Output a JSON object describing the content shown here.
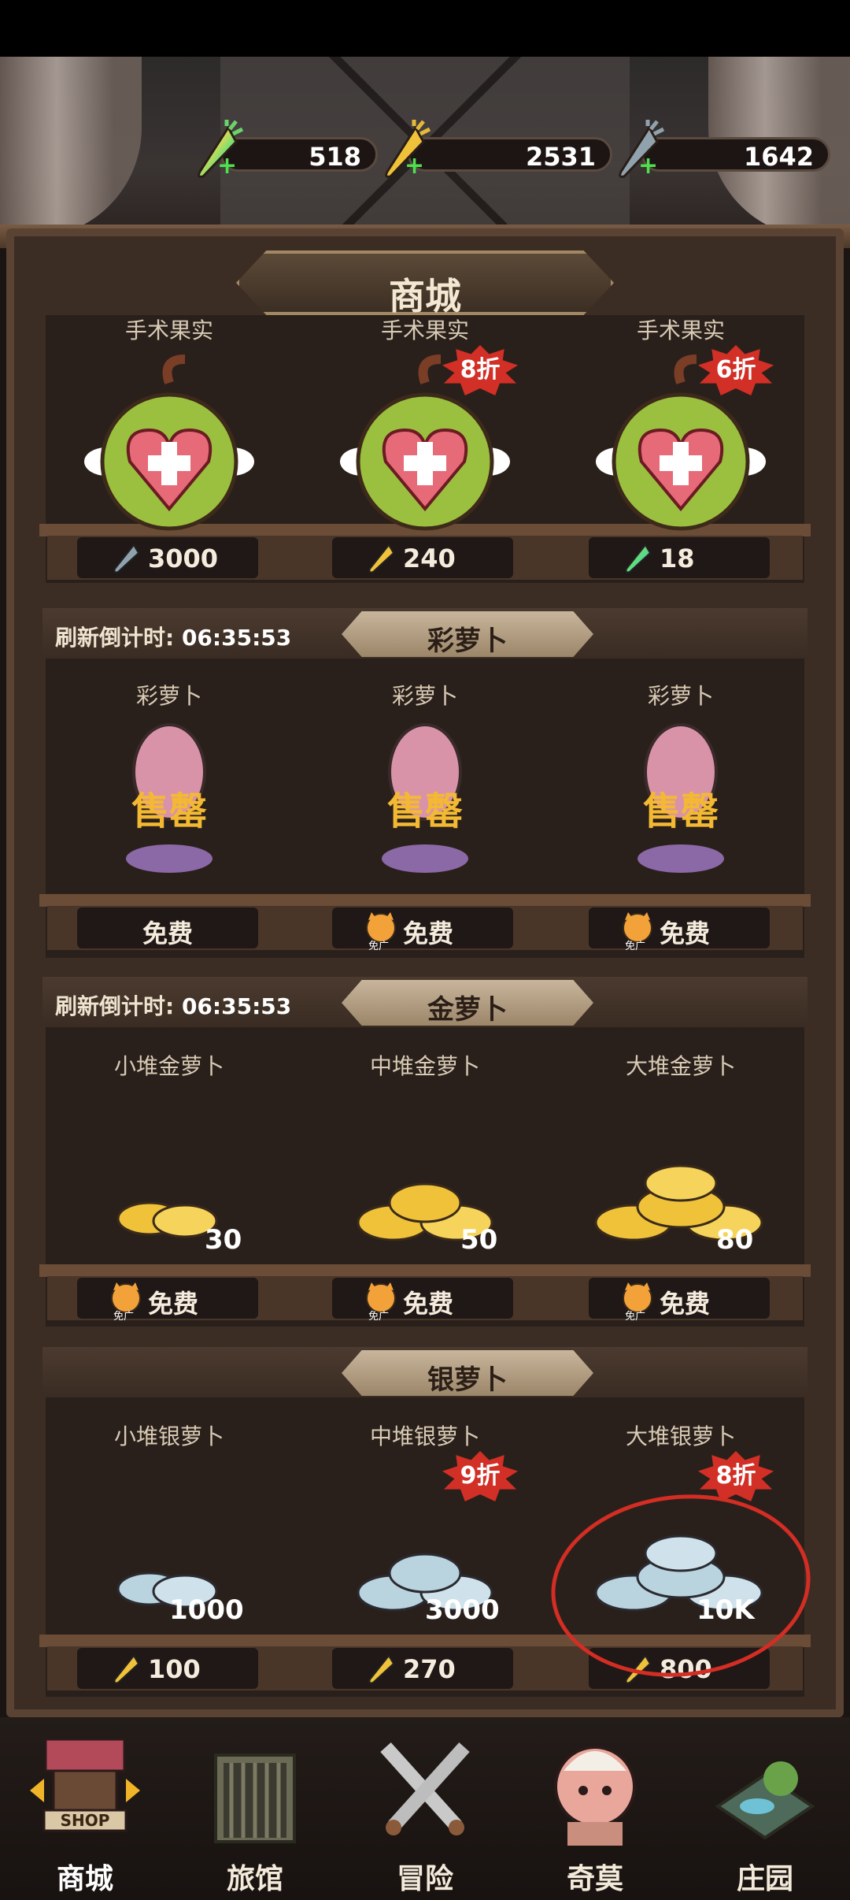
{
  "currencies": [
    {
      "value": "518",
      "icon": "rainbow-carrot-icon"
    },
    {
      "value": "2531",
      "icon": "gold-carrot-icon"
    },
    {
      "value": "1642",
      "icon": "silver-carrot-icon"
    }
  ],
  "shop_title": "商城",
  "sections": {
    "surgery": {
      "items": [
        {
          "name": "手术果实",
          "badge": "",
          "price": "3000",
          "price_icon": "silver-carrot-icon"
        },
        {
          "name": "手术果实",
          "badge": "8折",
          "price": "240",
          "price_icon": "gold-carrot-icon"
        },
        {
          "name": "手术果实",
          "badge": "6折",
          "price": "18",
          "price_icon": "rainbow-carrot-icon"
        }
      ]
    },
    "rainbow": {
      "timer_label": "刷新倒计时:",
      "timer_value": "06:35:53",
      "title": "彩萝卜",
      "sold_out": "售罄",
      "items": [
        {
          "name": "彩萝卜",
          "price": "免费",
          "ad": false
        },
        {
          "name": "彩萝卜",
          "price": "免费",
          "ad": true,
          "ad_label": "免广"
        },
        {
          "name": "彩萝卜",
          "price": "免费",
          "ad": true,
          "ad_label": "免广"
        }
      ]
    },
    "gold": {
      "timer_label": "刷新倒计时:",
      "timer_value": "06:35:53",
      "title": "金萝卜",
      "items": [
        {
          "name": "小堆金萝卜",
          "amount": "30",
          "price": "免费",
          "ad_label": "免广"
        },
        {
          "name": "中堆金萝卜",
          "amount": "50",
          "price": "免费",
          "ad_label": "免广"
        },
        {
          "name": "大堆金萝卜",
          "amount": "80",
          "price": "免费",
          "ad_label": "免广"
        }
      ]
    },
    "silver": {
      "title": "银萝卜",
      "items": [
        {
          "name": "小堆银萝卜",
          "amount": "1000",
          "badge": "",
          "price": "100",
          "price_icon": "gold-carrot-icon"
        },
        {
          "name": "中堆银萝卜",
          "amount": "3000",
          "badge": "9折",
          "price": "270",
          "price_icon": "gold-carrot-icon"
        },
        {
          "name": "大堆银萝卜",
          "amount": "10K",
          "badge": "8折",
          "price": "800",
          "price_icon": "gold-carrot-icon"
        }
      ]
    }
  },
  "nav": [
    {
      "label": "商城",
      "icon": "shop-icon",
      "badge": "SHOP"
    },
    {
      "label": "旅馆",
      "icon": "inn-gate-icon"
    },
    {
      "label": "冒险",
      "icon": "crossed-swords-icon"
    },
    {
      "label": "奇莫",
      "icon": "creature-icon"
    },
    {
      "label": "庄园",
      "icon": "island-icon"
    }
  ],
  "colors": {
    "badge_red": "#d22f26",
    "gold": "#f0c23a",
    "silver": "#b9d3df",
    "wood": "#3b2d23"
  }
}
